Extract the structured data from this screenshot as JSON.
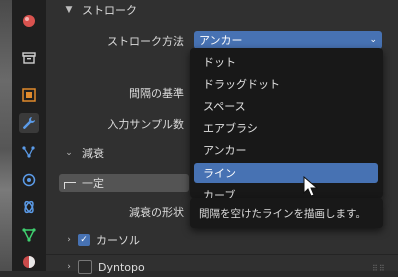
{
  "colors": {
    "accent": "#4772b3",
    "panel": "#303030",
    "menu": "#181818"
  },
  "tabs": [
    {
      "icon": "world-icon"
    },
    {
      "icon": "collection-icon"
    },
    {
      "icon": "object-icon"
    },
    {
      "icon": "wrench-icon"
    },
    {
      "icon": "particles-icon"
    },
    {
      "icon": "physics-icon"
    },
    {
      "icon": "constraints-icon"
    },
    {
      "icon": "data-icon"
    },
    {
      "icon": "material-icon"
    }
  ],
  "stroke_section": {
    "title": "ストローク",
    "method_label": "ストローク方法",
    "method_value": "アンカー",
    "spacing_label": "間隔の基準",
    "input_samples_label": "入力サンプル数"
  },
  "falloff_section": {
    "title": "減衰",
    "preset_value": "一定",
    "shape_label": "減衰の形状"
  },
  "cursor_section": {
    "title": "カーソル"
  },
  "dyntopo_section": {
    "title": "Dyntopo"
  },
  "stroke_method_menu": {
    "items": [
      "ドット",
      "ドラッグドット",
      "スペース",
      "エアブラシ",
      "アンカー",
      "ライン",
      "カーブ"
    ],
    "selected": "ライン"
  },
  "tooltip": {
    "text": "間隔を空けたラインを描画します。"
  }
}
